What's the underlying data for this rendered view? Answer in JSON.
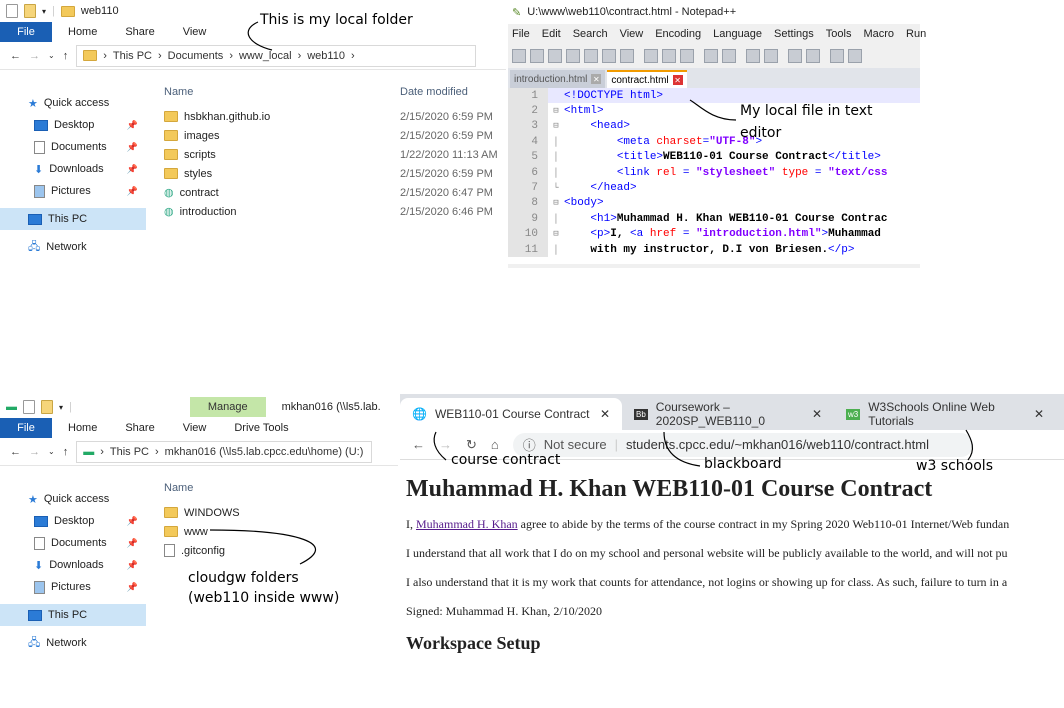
{
  "explorer1": {
    "title": "web110",
    "tabs": [
      "File",
      "Home",
      "Share",
      "View"
    ],
    "crumbs": [
      "This PC",
      "Documents",
      "www_local",
      "web110"
    ],
    "nav": [
      "Quick access",
      "Desktop",
      "Documents",
      "Downloads",
      "Pictures",
      "This PC",
      "Network"
    ],
    "col_name": "Name",
    "col_date": "Date modified",
    "files": [
      {
        "name": "hsbkhan.github.io",
        "date": "2/15/2020 6:59 PM"
      },
      {
        "name": "images",
        "date": "2/15/2020 6:59 PM"
      },
      {
        "name": "scripts",
        "date": "1/22/2020 11:13 AM"
      },
      {
        "name": "styles",
        "date": "2/15/2020 6:59 PM"
      },
      {
        "name": "contract",
        "date": "2/15/2020 6:47 PM"
      },
      {
        "name": "introduction",
        "date": "2/15/2020 6:46 PM"
      }
    ]
  },
  "notepad": {
    "title": "U:\\www\\web110\\contract.html - Notepad++",
    "menu": [
      "File",
      "Edit",
      "Search",
      "View",
      "Encoding",
      "Language",
      "Settings",
      "Tools",
      "Macro",
      "Run"
    ],
    "tabs": [
      "introduction.html",
      "contract.html"
    ],
    "lines": [
      "1",
      "2",
      "3",
      "4",
      "5",
      "6",
      "7",
      "8",
      "9",
      "10",
      "11"
    ]
  },
  "explorer2": {
    "manage": "Manage",
    "location": "mkhan016 (\\\\ls5.lab.",
    "tabs": [
      "File",
      "Home",
      "Share",
      "View",
      "Drive Tools"
    ],
    "crumbs": [
      "This PC",
      "mkhan016 (\\\\ls5.lab.cpcc.edu\\home) (U:)"
    ],
    "nav": [
      "Quick access",
      "Desktop",
      "Documents",
      "Downloads",
      "Pictures",
      "This PC",
      "Network"
    ],
    "col_name": "Name",
    "files": [
      "WINDOWS",
      "www",
      ".gitconfig"
    ]
  },
  "browser": {
    "tabs": [
      "WEB110-01 Course Contract",
      "Coursework – 2020SP_WEB110_0",
      "W3Schools Online Web Tutorials"
    ],
    "not_secure": "Not secure",
    "url": "students.cpcc.edu/~mkhan016/web110/contract.html",
    "heading": "Muhammad H. Khan WEB110-01 Course Contract",
    "p1_pre": "I, ",
    "p1_link": "Muhammad H. Khan",
    "p1_post": " agree to abide by the terms of the course contract in my Spring 2020 Web110-01 Internet/Web fundan",
    "p2": "I understand that all work that I do on my school and personal website will be publicly available to the world, and will not pu",
    "p3": "I also understand that it is my work that counts for attendance, not logins or showing up for class. As such, failure to turn in a",
    "signed": "Signed: Muhammad H. Khan, 2/10/2020",
    "h2": "Workspace Setup"
  },
  "annotations": {
    "local_folder": "This is my local folder",
    "local_file": "My local file in text editor",
    "cloud": "cloudgw folders (web110 inside www)",
    "contract": "course contract",
    "blackboard": "blackboard",
    "w3": "w3 schools"
  }
}
